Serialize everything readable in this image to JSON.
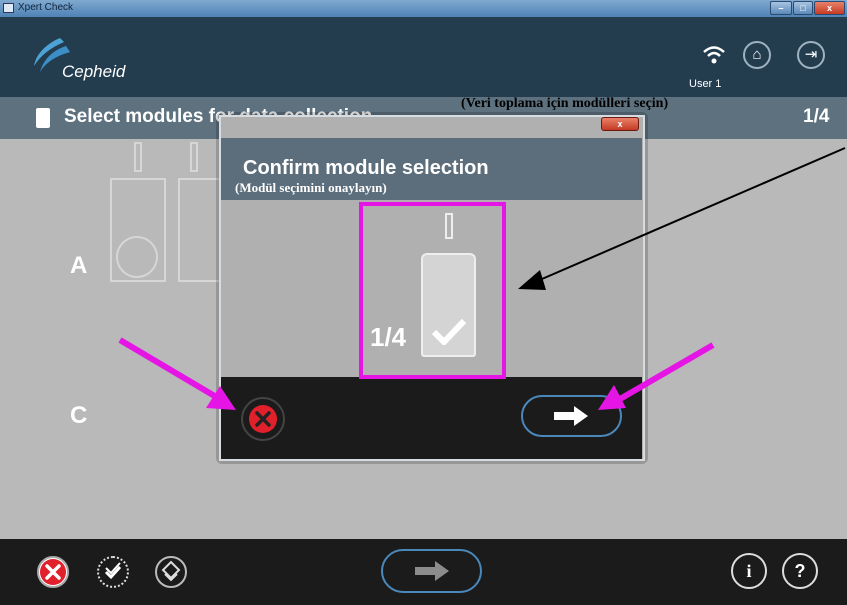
{
  "window": {
    "title": "Xpert Check",
    "min_label": "–",
    "max_label": "□",
    "close_label": "x"
  },
  "header": {
    "logo_text": "Cepheid",
    "user_label": "User 1",
    "wifi_icon": "wifi-icon",
    "home_icon": "home-icon",
    "exit_icon": "exit-icon"
  },
  "page": {
    "title": "Select modules for data collection",
    "translation": "(Veri toplama için modülleri seçin)",
    "counter": "1/4"
  },
  "rows": {
    "a": "A",
    "c": "C"
  },
  "dialog": {
    "title": "Confirm module selection",
    "subtitle": "(Modül seçimini onaylayın)",
    "close_label": "x",
    "module_fraction": "1/4",
    "cancel_icon": "cancel-icon",
    "next_icon": "arrow-right-icon"
  },
  "footer": {
    "info_label": "i",
    "help_label": "?"
  },
  "colors": {
    "header_bg": "#233d4f",
    "page_bar": "#5d717f",
    "content_bg": "#b9b9b9",
    "footer_bg": "#1b1b1b",
    "cancel_red": "#e0202a",
    "annotation_magenta": "#e516e5"
  }
}
